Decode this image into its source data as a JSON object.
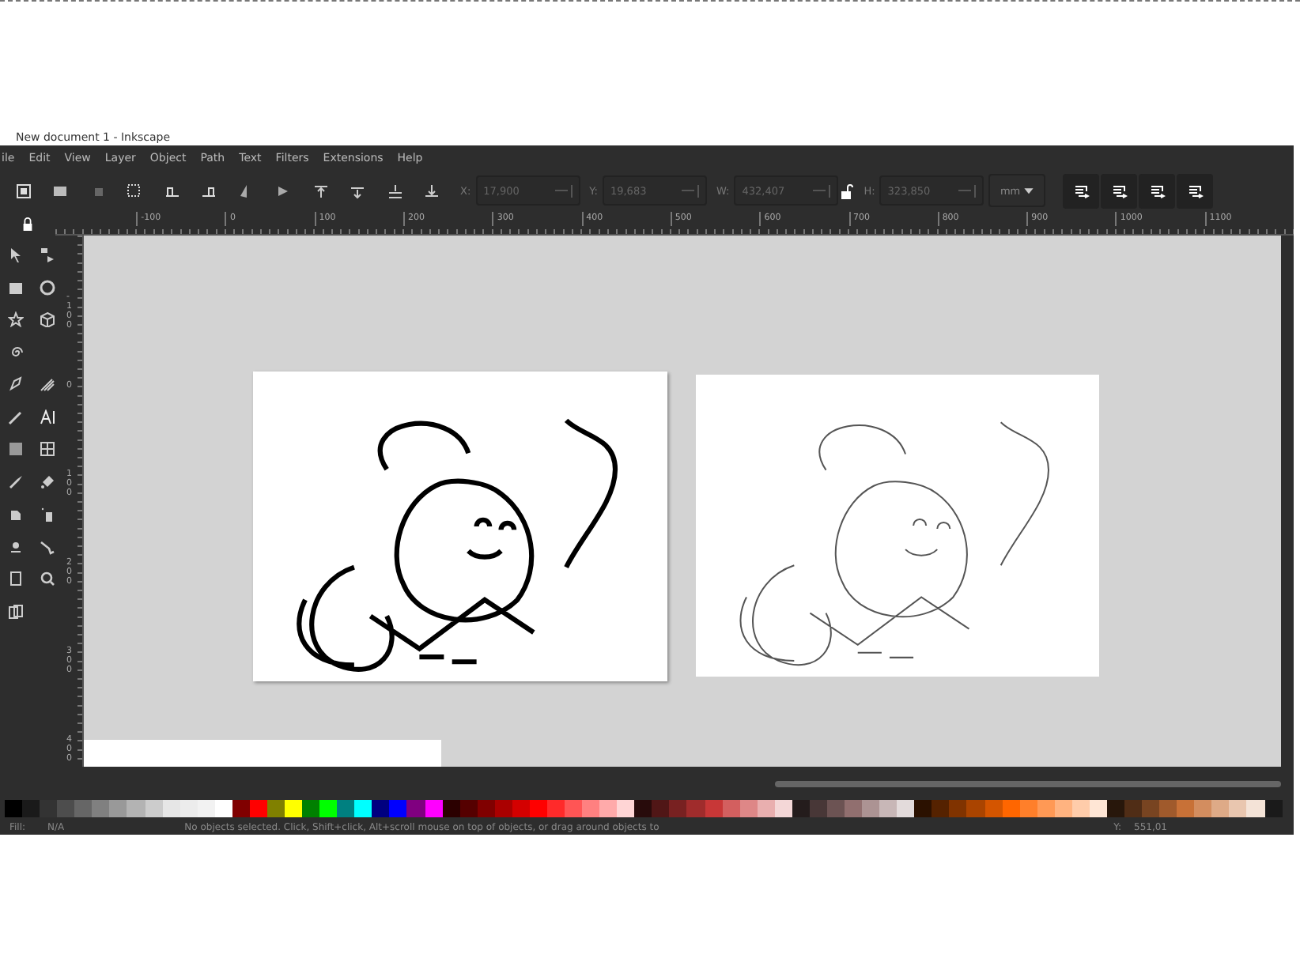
{
  "window": {
    "title": "New document 1 - Inkscape"
  },
  "menu": [
    "ile",
    "Edit",
    "View",
    "Layer",
    "Object",
    "Path",
    "Text",
    "Filters",
    "Extensions",
    "Help"
  ],
  "toolbar": {
    "fields": [
      {
        "label": "X:",
        "value": "17,900"
      },
      {
        "label": "Y:",
        "value": "19,683"
      },
      {
        "label": "W:",
        "value": "432,407"
      },
      {
        "kind": "lock"
      },
      {
        "label": "H:",
        "value": "323,850"
      }
    ],
    "unit": "mm"
  },
  "ruler_horizontal": [
    "-100",
    "0",
    "100",
    "200",
    "300",
    "400",
    "500",
    "600",
    "700",
    "800",
    "900",
    "1000",
    "1100"
  ],
  "ruler_vertical": [
    "-100",
    "0",
    "100",
    "200",
    "300",
    "400"
  ],
  "palette": [
    {
      "color": "#000000"
    },
    {
      "color": "#1a1a1a"
    },
    {
      "color": "#333333"
    },
    {
      "color": "#4d4d4d"
    },
    {
      "color": "#666666"
    },
    {
      "color": "#808080"
    },
    {
      "color": "#999999"
    },
    {
      "color": "#b3b3b3"
    },
    {
      "color": "#cccccc"
    },
    {
      "color": "#e6e6e6"
    },
    {
      "color": "#ececec"
    },
    {
      "color": "#f2f2f2"
    },
    {
      "color": "#ffffff"
    },
    {
      "color": "#800000"
    },
    {
      "color": "#ff0000"
    },
    {
      "color": "#808000"
    },
    {
      "color": "#ffff00"
    },
    {
      "color": "#008000"
    },
    {
      "color": "#00ff00"
    },
    {
      "color": "#008080"
    },
    {
      "color": "#00ffff"
    },
    {
      "color": "#000080"
    },
    {
      "color": "#0000ff"
    },
    {
      "color": "#800080"
    },
    {
      "color": "#ff00ff"
    },
    {
      "color": "#2b0000"
    },
    {
      "color": "#550000"
    },
    {
      "color": "#800000"
    },
    {
      "color": "#aa0000"
    },
    {
      "color": "#d40000"
    },
    {
      "color": "#ff0000"
    },
    {
      "color": "#ff2a2a"
    },
    {
      "color": "#ff5555"
    },
    {
      "color": "#ff8080"
    },
    {
      "color": "#ffaaaa"
    },
    {
      "color": "#ffd5d5"
    },
    {
      "color": "#280b0b"
    },
    {
      "color": "#501616"
    },
    {
      "color": "#782121"
    },
    {
      "color": "#a02c2c"
    },
    {
      "color": "#c83737"
    },
    {
      "color": "#d35f5f"
    },
    {
      "color": "#de8787"
    },
    {
      "color": "#e9afaf"
    },
    {
      "color": "#f4d7d7"
    },
    {
      "color": "#241c1c"
    },
    {
      "color": "#483737"
    },
    {
      "color": "#6c5353"
    },
    {
      "color": "#916f6f"
    },
    {
      "color": "#ac9393"
    },
    {
      "color": "#c8b7b7"
    },
    {
      "color": "#e3dbdb"
    },
    {
      "color": "#2b1100"
    },
    {
      "color": "#552200"
    },
    {
      "color": "#803300"
    },
    {
      "color": "#aa4400"
    },
    {
      "color": "#d45500"
    },
    {
      "color": "#ff6600"
    },
    {
      "color": "#ff7f2a"
    },
    {
      "color": "#ff9955"
    },
    {
      "color": "#ffb380"
    },
    {
      "color": "#ffccaa"
    },
    {
      "color": "#ffe6d5"
    },
    {
      "color": "#28170b"
    },
    {
      "color": "#502d16"
    },
    {
      "color": "#784421"
    },
    {
      "color": "#a05a2c"
    },
    {
      "color": "#c87137"
    },
    {
      "color": "#d38d5f"
    },
    {
      "color": "#deaa87"
    },
    {
      "color": "#e9c6af"
    },
    {
      "color": "#f4e3d7"
    },
    {
      "color": "#1a1a1a"
    }
  ],
  "status_bar": {
    "fill_label": "Fill:",
    "fill_value": "N/A",
    "message": "No objects selected. Click, Shift+click, Alt+scroll mouse on top of objects, or drag around objects to",
    "y_label": "Y:",
    "y_value": "551,01"
  }
}
